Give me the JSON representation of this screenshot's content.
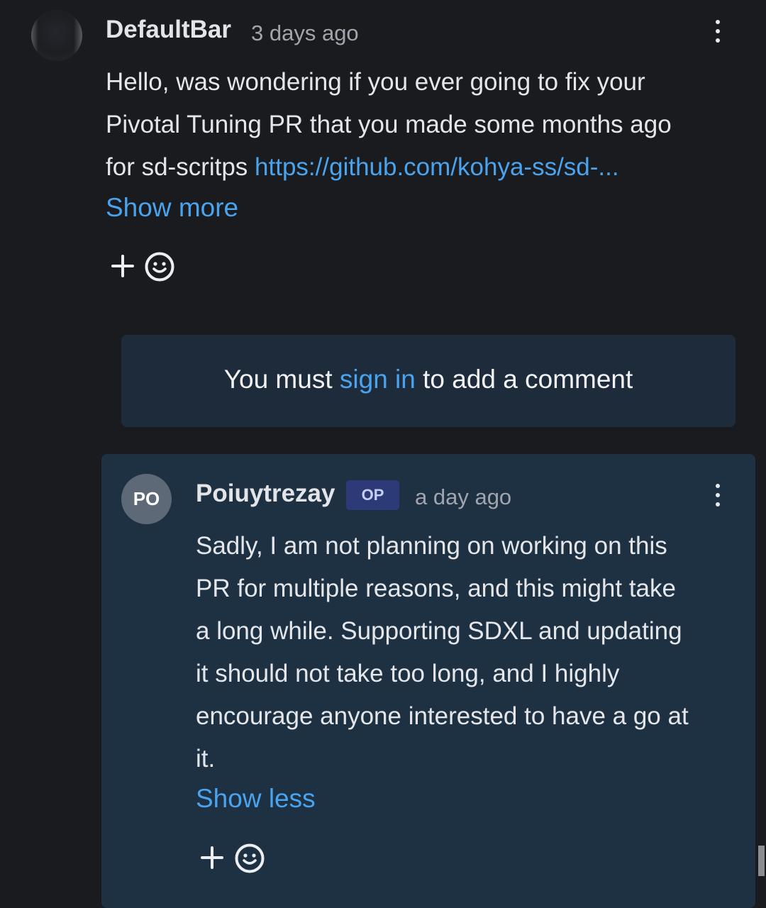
{
  "comment1": {
    "author": "DefaultBar",
    "time": "3 days ago",
    "lines": [
      "Hello, was wondering if you ever going to fix your",
      "Pivotal Tuning PR that you made some months ago",
      "for sd-scritps "
    ],
    "link_text": "https://github.com/kohya-ss/sd-...",
    "toggle": "Show more",
    "menu_icon": "more-vert-icon"
  },
  "signin": {
    "prefix": "You must ",
    "link": "sign in",
    "suffix": " to add a comment"
  },
  "reply": {
    "avatar_initials": "PO",
    "author": "Poiuytrezay",
    "badge": "OP",
    "time": "a day ago",
    "lines": [
      "Sadly, I am not planning on working on this",
      "PR for multiple reasons, and this might take",
      "a long while. Supporting SDXL and updating",
      "it should not take too long, and I highly",
      "encourage anyone interested to have a go at",
      "it."
    ],
    "toggle": "Show less",
    "menu_icon": "more-vert-icon"
  },
  "colors": {
    "background": "#1a1b1e",
    "card": "#1e3143",
    "signin_box": "#1e2b3a",
    "link": "#4aa3ee",
    "op_badge": "#2c3a78"
  }
}
